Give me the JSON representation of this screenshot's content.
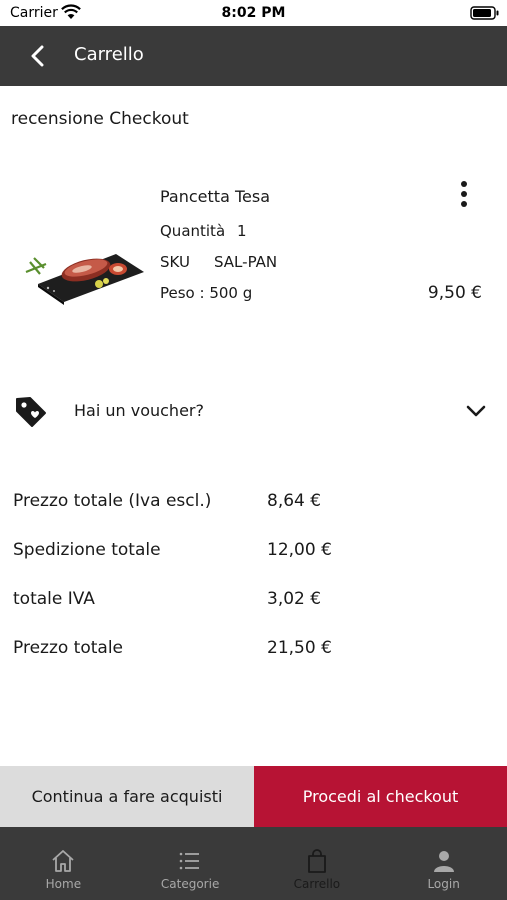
{
  "status_bar": {
    "carrier": "Carrier",
    "time": "8:02 PM",
    "icons": [
      "wifi-icon",
      "battery-icon"
    ]
  },
  "header": {
    "title": "Carrello",
    "back_icon": "chevron-left-icon",
    "background": "#3a3a3a"
  },
  "checkout": {
    "section_title": "recensione Checkout"
  },
  "product": {
    "name": "Pancetta Tesa",
    "quantity_label": "Quantità",
    "quantity_value": "1",
    "sku_label": "SKU",
    "sku_value": "SAL-PAN",
    "weight_text": "Peso : 500 g",
    "price": "9,50 €",
    "menu_icon": "more-vertical-icon",
    "image": "cured-bacon-on-slate-image"
  },
  "voucher": {
    "label": "Hai un voucher?",
    "icon": "tag-icon",
    "chevron": "chevron-down-icon"
  },
  "totals": [
    {
      "label": "Prezzo totale (Iva escl.)",
      "value": "8,64 €"
    },
    {
      "label": "Spedizione totale",
      "value": "12,00 €"
    },
    {
      "label": "totale IVA",
      "value": "3,02 €"
    },
    {
      "label": "Prezzo totale",
      "value": "21,50 €"
    }
  ],
  "actions": {
    "continue_label": "Continua a fare acquisti",
    "checkout_label": "Procedi al checkout",
    "checkout_color": "#b71334"
  },
  "tabbar": {
    "items": [
      {
        "label": "Home",
        "icon": "home-icon",
        "active": false
      },
      {
        "label": "Categorie",
        "icon": "list-icon",
        "active": false
      },
      {
        "label": "Carrello",
        "icon": "shopping-bag-icon",
        "active": true
      },
      {
        "label": "Login",
        "icon": "user-icon",
        "active": false
      }
    ]
  }
}
